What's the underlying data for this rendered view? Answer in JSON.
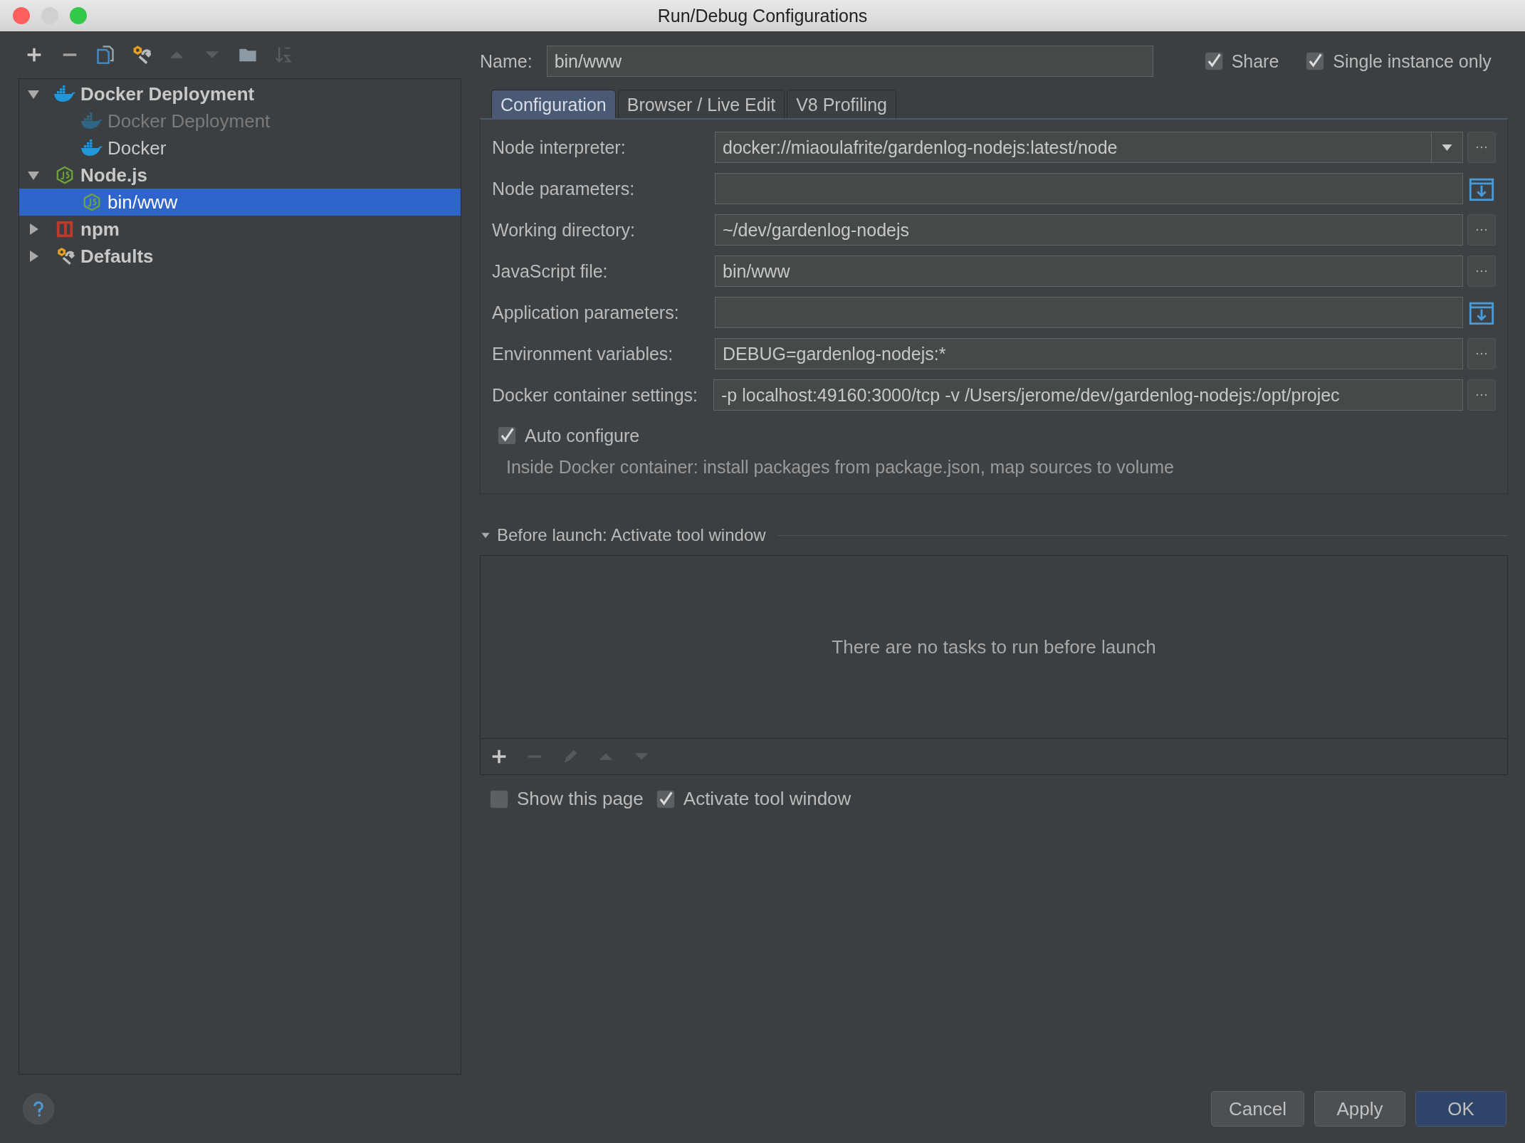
{
  "window": {
    "title": "Run/Debug Configurations"
  },
  "tree": [
    {
      "label": "Docker Deployment",
      "kind": "docker",
      "expanded": true,
      "children": [
        {
          "label": "Docker Deployment",
          "kind": "docker",
          "disabled": true,
          "selected": false
        },
        {
          "label": "Docker",
          "kind": "docker",
          "disabled": false,
          "selected": false
        }
      ]
    },
    {
      "label": "Node.js",
      "kind": "node",
      "expanded": true,
      "children": [
        {
          "label": "bin/www",
          "kind": "node",
          "disabled": false,
          "selected": true
        }
      ]
    },
    {
      "label": "npm",
      "kind": "npm",
      "expanded": false
    },
    {
      "label": "Defaults",
      "kind": "defaults",
      "expanded": false
    }
  ],
  "name": {
    "label": "Name:",
    "value": "bin/www"
  },
  "options": [
    {
      "label": "Share",
      "checked": true
    },
    {
      "label": "Single instance only",
      "checked": true
    }
  ],
  "tabs": [
    {
      "label": "Configuration",
      "selected": true
    },
    {
      "label": "Browser / Live Edit",
      "selected": false
    },
    {
      "label": "V8 Profiling",
      "selected": false
    }
  ],
  "fields": [
    {
      "label": "Node interpreter:",
      "value": "docker://miaoulafrite/gardenlog-nodejs:latest/node",
      "kind": "dropdown"
    },
    {
      "label": "Node parameters:",
      "kind": "expand"
    },
    {
      "label": "Working directory:",
      "value": "~/dev/gardenlog-nodejs",
      "kind": "browse"
    },
    {
      "label": "JavaScript file:",
      "value": "bin/www",
      "kind": "browse"
    },
    {
      "label": "Application parameters:",
      "kind": "expand"
    },
    {
      "label": "Environment variables:",
      "value": "DEBUG=gardenlog-nodejs:*",
      "kind": "browse"
    },
    {
      "label": "Docker container settings:",
      "value": "-p localhost:49160:3000/tcp -v /Users/jerome/dev/gardenlog-nodejs:/opt/projec",
      "kind": "browse"
    }
  ],
  "auto_configure": {
    "label": "Auto configure",
    "checked": true,
    "hint": "Inside Docker container: install packages from package.json, map sources to volume"
  },
  "before_launch": {
    "title": "Before launch: Activate tool window",
    "expanded": true,
    "empty_text": "There are no tasks to run before launch"
  },
  "launch_options": [
    {
      "label": "Show this page",
      "checked": false
    },
    {
      "label": "Activate tool window",
      "checked": true
    }
  ],
  "buttons": [
    {
      "label": "Cancel",
      "kind": "normal"
    },
    {
      "label": "Apply",
      "kind": "normal"
    },
    {
      "label": "OK",
      "kind": "default"
    }
  ]
}
